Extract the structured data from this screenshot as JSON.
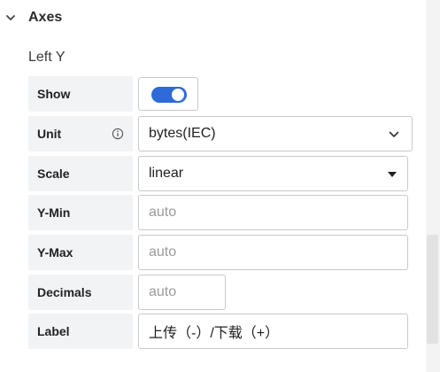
{
  "section": {
    "title": "Axes",
    "expanded": true,
    "chevron_icon": "chevron-down-icon"
  },
  "left_y": {
    "heading": "Left Y",
    "show": {
      "label": "Show",
      "checked": true,
      "accent_color": "#2f6ad9"
    },
    "unit": {
      "label": "Unit",
      "value": "bytes(IEC)",
      "info_icon": "info-icon"
    },
    "scale": {
      "label": "Scale",
      "value": "linear"
    },
    "y_min": {
      "label": "Y-Min",
      "placeholder": "auto"
    },
    "y_max": {
      "label": "Y-Max",
      "placeholder": "auto"
    },
    "decimals": {
      "label": "Decimals",
      "placeholder": "auto"
    },
    "axis_label": {
      "label": "Label",
      "value": "上传（-）/下载（+）"
    }
  }
}
